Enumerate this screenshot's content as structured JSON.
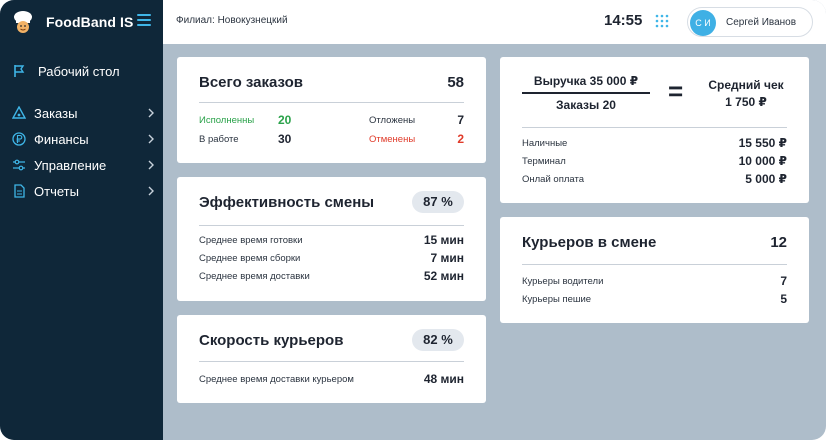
{
  "app": {
    "name": "FoodBand IS",
    "branch": "Филиал: Новокузнецкий",
    "time": "14:55",
    "user_initials": "С И",
    "user_name": "Сергей Иванов"
  },
  "sidebar": {
    "top_item": {
      "label": "Рабочий стол",
      "icon": "flag-icon"
    },
    "items": [
      {
        "label": "Заказы",
        "icon": "orders-icon"
      },
      {
        "label": "Финансы",
        "icon": "ruble-icon"
      },
      {
        "label": "Управление",
        "icon": "sliders-icon"
      },
      {
        "label": "Отчеты",
        "icon": "document-icon"
      }
    ]
  },
  "orders": {
    "title": "Всего заказов",
    "total": "58",
    "done_label": "Исполненны",
    "done_value": "20",
    "work_label": "В работе",
    "work_value": "30",
    "postponed_label": "Отложены",
    "postponed_value": "7",
    "cancelled_label": "Отменены",
    "cancelled_value": "2"
  },
  "efficiency": {
    "title": "Эффективность смены",
    "percent": "87 %",
    "rows": [
      {
        "label": "Среднее время готовки",
        "value": "15 мин"
      },
      {
        "label": "Среднее время сборки",
        "value": "7 мин"
      },
      {
        "label": "Среднее время доставки",
        "value": "52 мин"
      }
    ]
  },
  "speed": {
    "title": "Скорость курьеров",
    "percent": "82 %",
    "rows": [
      {
        "label": "Среднее время доставки курьером",
        "value": "48 мин"
      }
    ]
  },
  "revenue": {
    "numerator": "Выручка 35 000 ₽",
    "denominator": "Заказы 20",
    "equals": "=",
    "avg_label": "Средний чек",
    "avg_value": "1 750 ₽",
    "rows": [
      {
        "label": "Наличные",
        "value": "15 550 ₽"
      },
      {
        "label": "Терминал",
        "value": "10 000 ₽"
      },
      {
        "label": "Онлай оплата",
        "value": "5 000 ₽"
      }
    ]
  },
  "couriers": {
    "title": "Курьеров в смене",
    "total": "12",
    "rows": [
      {
        "label": "Курьеры водители",
        "value": "7"
      },
      {
        "label": "Курьеры пешие",
        "value": "5"
      }
    ]
  },
  "colors": {
    "sidebar_bg": "#0f2739",
    "accent": "#3fb6e8",
    "content_bg": "#aebdca",
    "positive": "#2aa24a",
    "negative": "#e03b2a"
  }
}
